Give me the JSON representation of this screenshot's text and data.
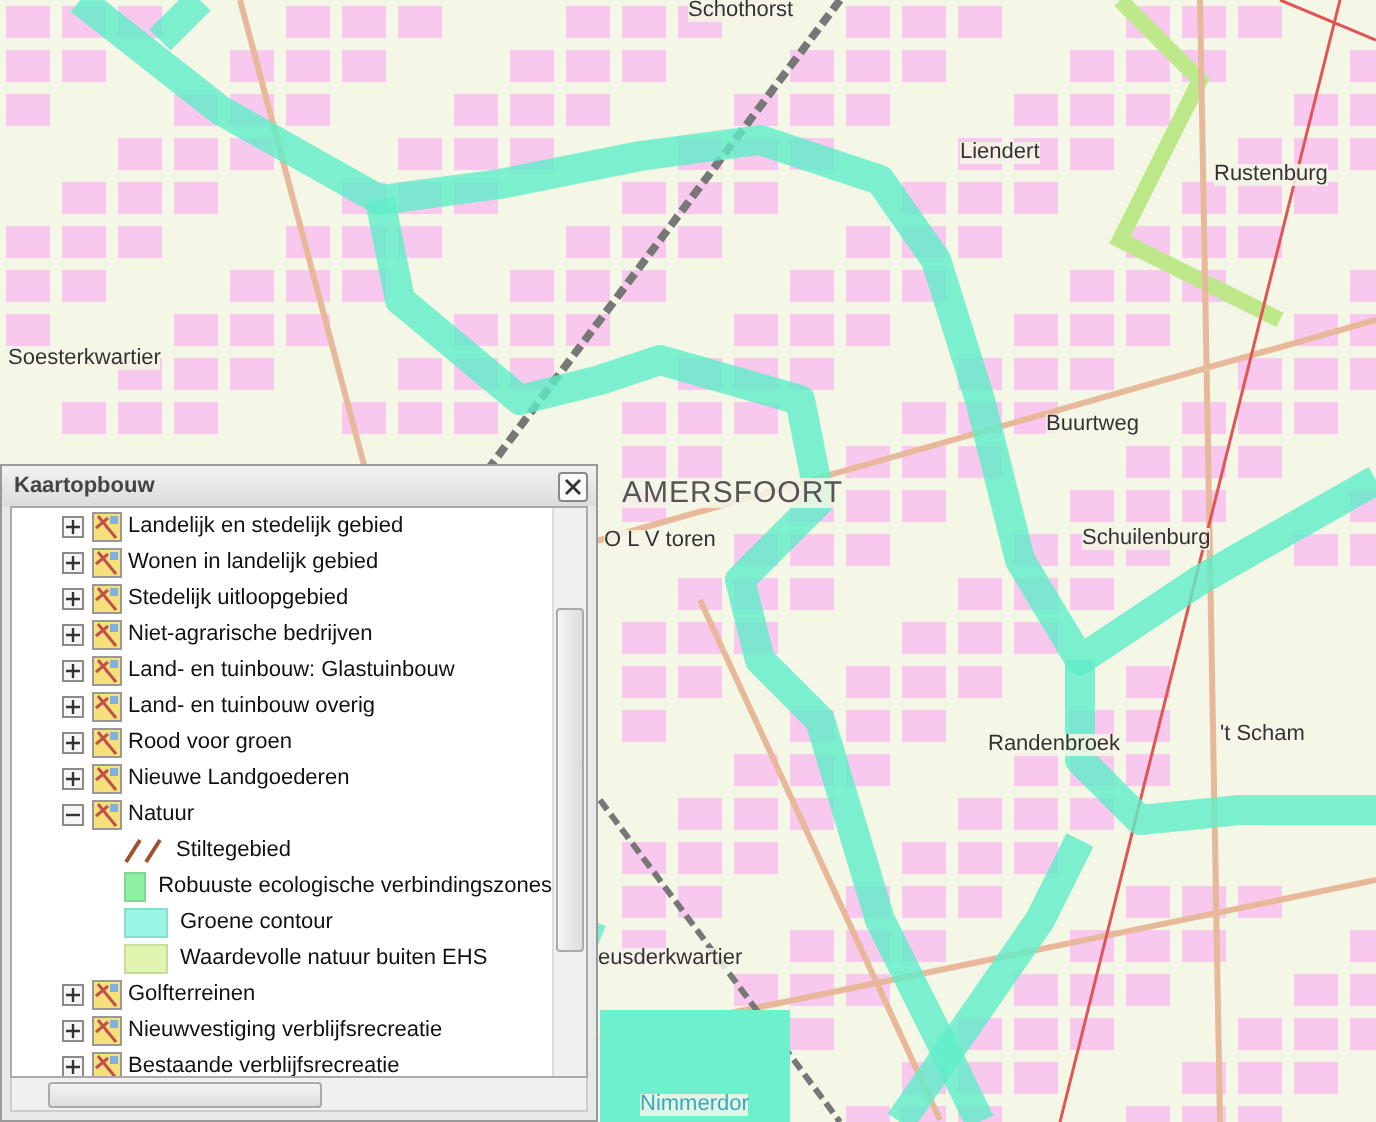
{
  "map": {
    "labels": [
      {
        "text": "Schothorst",
        "kind": "place"
      },
      {
        "text": "Liendert",
        "kind": "place"
      },
      {
        "text": "Rustenburg",
        "kind": "place"
      },
      {
        "text": "Soesterkwartier",
        "kind": "place"
      },
      {
        "text": "Buurtweg",
        "kind": "place"
      },
      {
        "text": "AMERSFOORT",
        "kind": "city"
      },
      {
        "text": "O L V toren",
        "kind": "place"
      },
      {
        "text": "Schuilenburg",
        "kind": "place"
      },
      {
        "text": "Randenbroek",
        "kind": "place"
      },
      {
        "text": "'t Scham",
        "kind": "place"
      },
      {
        "text": "eusderkwartier",
        "kind": "place"
      },
      {
        "text": "Nimmerdor",
        "kind": "water"
      }
    ]
  },
  "legend": {
    "title": "Kaartopbouw",
    "items": [
      {
        "label": "Landelijk en stedelijk gebied",
        "expanded": false
      },
      {
        "label": "Wonen in landelijk gebied",
        "expanded": false
      },
      {
        "label": "Stedelijk uitloopgebied",
        "expanded": false
      },
      {
        "label": "Niet-agrarische bedrijven",
        "expanded": false
      },
      {
        "label": "Land- en tuinbouw: Glastuinbouw",
        "expanded": false
      },
      {
        "label": "Land- en tuinbouw overig",
        "expanded": false
      },
      {
        "label": "Rood voor groen",
        "expanded": false
      },
      {
        "label": "Nieuwe Landgoederen",
        "expanded": false
      },
      {
        "label": "Natuur",
        "expanded": true,
        "children": [
          {
            "label": "Stiltegebied",
            "kind": "hatch",
            "color": "#a0522d"
          },
          {
            "label": "Robuuste ecologische verbindingszones",
            "kind": "swatch",
            "color": "#8ef0a0"
          },
          {
            "label": "Groene contour",
            "kind": "swatch",
            "color": "#99f5e6"
          },
          {
            "label": "Waardevolle natuur buiten EHS",
            "kind": "swatch",
            "color": "#e0f5b0"
          }
        ]
      },
      {
        "label": "Golfterreinen",
        "expanded": false
      },
      {
        "label": "Nieuwvestiging verblijfsrecreatie",
        "expanded": false
      },
      {
        "label": "Bestaande verblijfsrecreatie",
        "expanded": false
      }
    ]
  }
}
